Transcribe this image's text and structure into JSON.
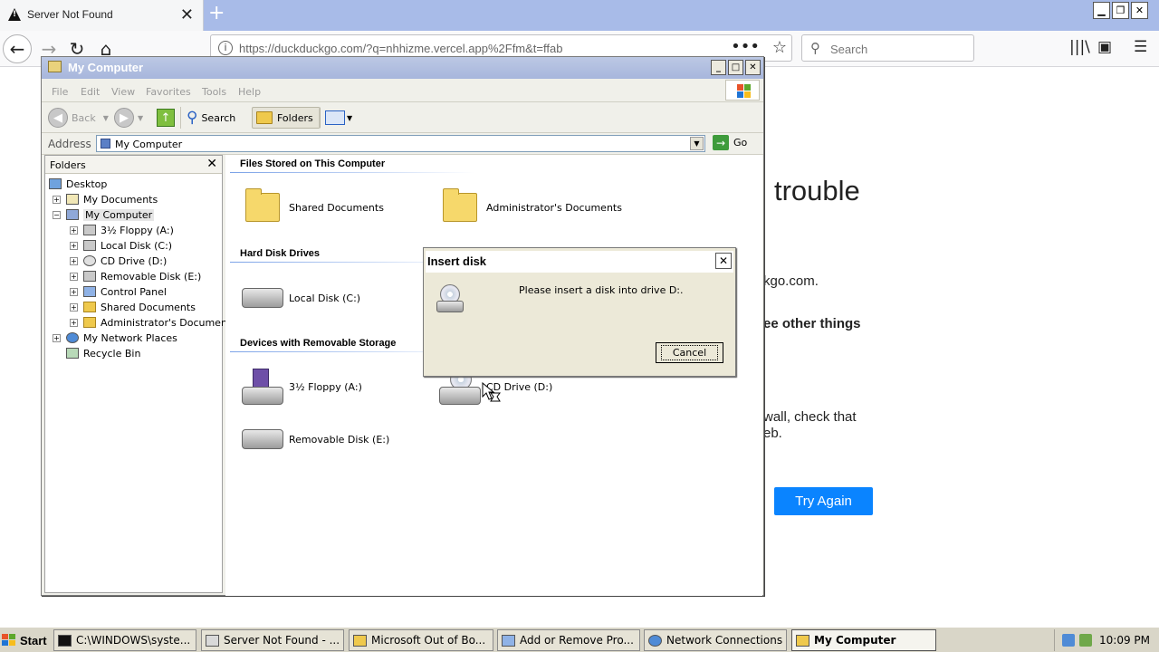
{
  "browser": {
    "tab_title": "Server Not Found",
    "tab_close": "✕",
    "new_tab": "+",
    "url": "https://duckduckgo.com/?q=nhhizme.vercel.app%2Ffm&t=ffab",
    "search_placeholder": "Search",
    "window_controls": [
      "▁",
      "❐",
      "✕"
    ]
  },
  "error_page": {
    "title_fragment": "trouble",
    "line1": "kgo.com.",
    "line2": "ee other things",
    "line3": "wall, check that",
    "line4": "eb.",
    "button": "Try Again",
    "button_color": "#0a84ff"
  },
  "explorer": {
    "title": "My Computer",
    "title_buttons": [
      "_",
      "□",
      "✕"
    ],
    "menu": [
      "File",
      "Edit",
      "View",
      "Favorites",
      "Tools",
      "Help"
    ],
    "toolbar": {
      "back": "Back",
      "search": "Search",
      "folders": "Folders"
    },
    "address_label": "Address",
    "address_value": "My Computer",
    "go_label": "Go",
    "folders_pane": {
      "title": "Folders",
      "close": "✕",
      "items": [
        {
          "label": "Desktop",
          "expander": ""
        },
        {
          "label": "My Documents",
          "expander": "+"
        },
        {
          "label": "My Computer",
          "expander": "−"
        },
        {
          "label": "3½ Floppy (A:)",
          "expander": "+"
        },
        {
          "label": "Local Disk (C:)",
          "expander": "+"
        },
        {
          "label": "CD Drive (D:)",
          "expander": "+"
        },
        {
          "label": "Removable Disk (E:)",
          "expander": "+"
        },
        {
          "label": "Control Panel",
          "expander": "+"
        },
        {
          "label": "Shared Documents",
          "expander": "+"
        },
        {
          "label": "Administrator's Documents",
          "expander": "+"
        },
        {
          "label": "My Network Places",
          "expander": "+"
        },
        {
          "label": "Recycle Bin",
          "expander": ""
        }
      ]
    },
    "groups": {
      "files": "Files Stored on This Computer",
      "hdd": "Hard Disk Drives",
      "removable": "Devices with Removable Storage"
    },
    "items": {
      "shared_docs": "Shared Documents",
      "admin_docs": "Administrator's Documents",
      "local_disk": "Local Disk (C:)",
      "floppy": "3½ Floppy (A:)",
      "cd_drive": "CD Drive (D:)",
      "removable": "Removable Disk (E:)"
    }
  },
  "dialog": {
    "title": "Insert disk",
    "close": "✕",
    "message": "Please insert a disk into drive D:.",
    "cancel": "Cancel"
  },
  "taskbar": {
    "start": "Start",
    "tasks": [
      "C:\\WINDOWS\\syste...",
      "Server Not Found - ...",
      "Microsoft Out of Bo...",
      "Add or Remove Pro...",
      "Network Connections",
      "My Computer"
    ],
    "clock": "10:09 PM"
  }
}
